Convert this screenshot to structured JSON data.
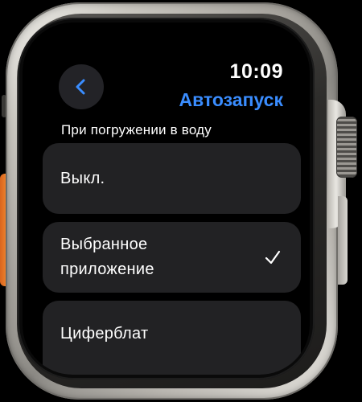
{
  "status": {
    "time": "10:09"
  },
  "header": {
    "title": "Автозапуск",
    "back_icon": "chevron-left-icon"
  },
  "section": {
    "header": "При погружении в воду"
  },
  "options": [
    {
      "label": "Выкл.",
      "selected": false
    },
    {
      "label_line1": "Выбранное",
      "label_line2": "приложение",
      "selected": true
    },
    {
      "label": "Циферблат",
      "selected": false
    }
  ],
  "colors": {
    "accent": "#3a8dff",
    "row_background": "#222224",
    "action_button": "#f28a30"
  }
}
